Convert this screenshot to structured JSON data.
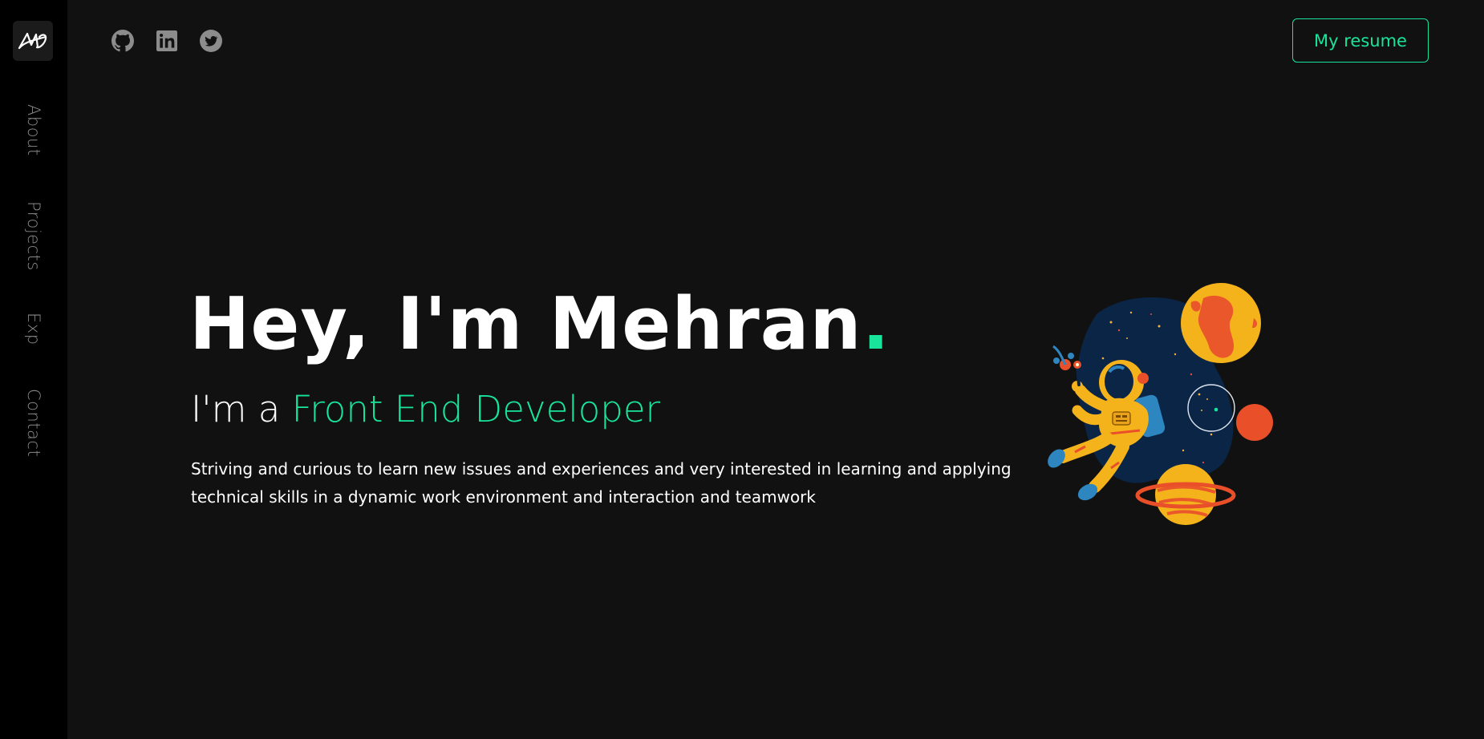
{
  "sidebar": {
    "logo": "AM",
    "items": [
      {
        "label": "About"
      },
      {
        "label": "Projects"
      },
      {
        "label": "Exp"
      },
      {
        "label": "Contact"
      }
    ]
  },
  "header": {
    "social": [
      {
        "icon": "github-icon"
      },
      {
        "icon": "linkedin-icon"
      },
      {
        "icon": "twitter-icon"
      }
    ],
    "resume_label": "My resume"
  },
  "hero": {
    "title": "Hey, I'm Mehran",
    "title_dot": ".",
    "subtitle_prefix": "I'm a ",
    "subtitle_role": "Front End Developer",
    "description": "Striving and curious to learn new issues and experiences and very interested in learning and applying technical skills in a dynamic work environment and interaction and teamwork"
  },
  "colors": {
    "accent": "#18e59b",
    "background": "#111111",
    "sidebar": "#000000"
  }
}
